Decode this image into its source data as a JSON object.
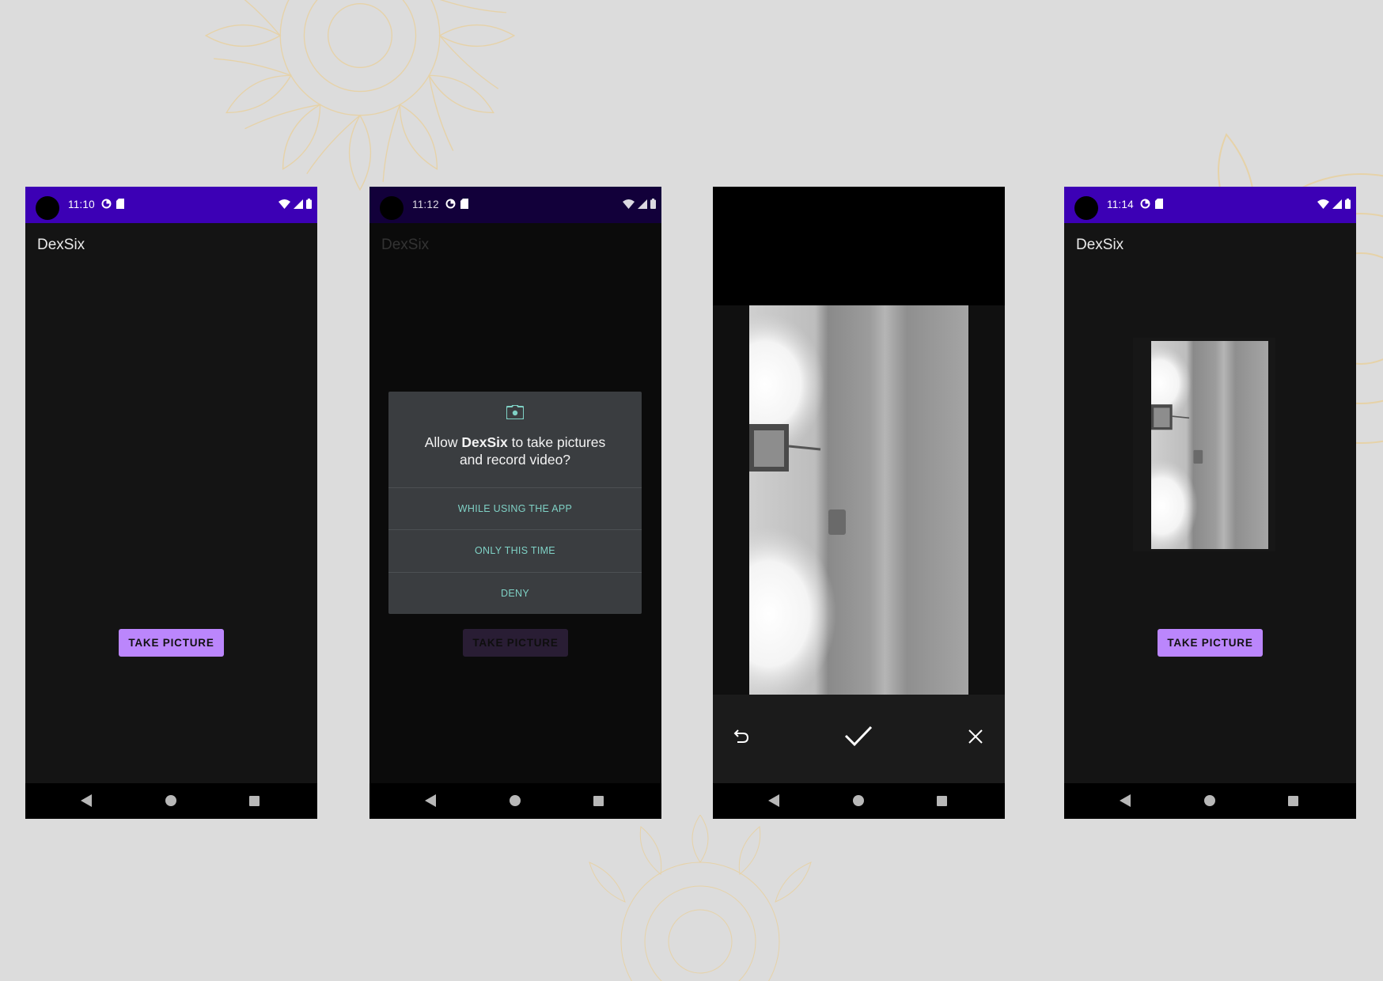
{
  "app": {
    "name": "DexSix"
  },
  "screens": [
    {
      "id": "screen-1",
      "status_time": "11:10",
      "button_label": "TAKE PICTURE"
    },
    {
      "id": "screen-2",
      "status_time": "11:12",
      "button_label": "TAKE PICTURE",
      "dialog": {
        "prefix": "Allow ",
        "app_name": "DexSix",
        "suffix": " to take pictures",
        "line2": "and record video?",
        "options": [
          "WHILE USING THE APP",
          "ONLY THIS TIME",
          "DENY"
        ]
      }
    },
    {
      "id": "screen-3",
      "controls": [
        "retake-icon",
        "confirm-check-icon",
        "cancel-x-icon"
      ]
    },
    {
      "id": "screen-4",
      "status_time": "11:14",
      "button_label": "TAKE PICTURE"
    }
  ],
  "colors": {
    "status_bar": "#3c00b5",
    "button": "#bb86fc",
    "dialog_accent": "#7fd1c5",
    "dialog_bg": "#3a3d40",
    "app_bg": "#141414"
  },
  "icons": {
    "status_notifs": [
      "data-saver-icon",
      "sd-card-icon"
    ],
    "status_right": [
      "wifi-icon",
      "signal-icon",
      "battery-icon"
    ],
    "nav": [
      "back-icon",
      "home-icon",
      "recents-icon"
    ],
    "dialog": "camera-icon"
  }
}
